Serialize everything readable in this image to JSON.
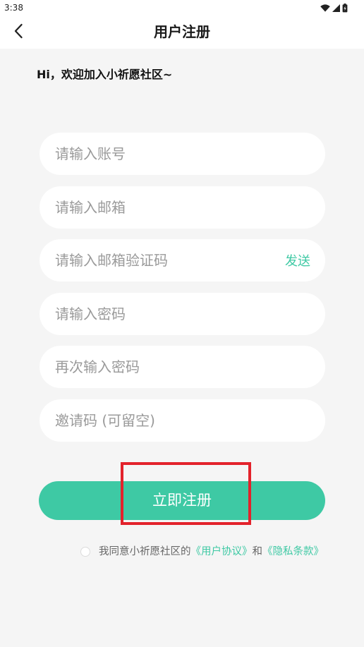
{
  "status_bar": {
    "time": "3:38",
    "icons": [
      "wifi-icon",
      "signal-icon",
      "battery-icon"
    ]
  },
  "header": {
    "title": "用户注册",
    "back_icon": "chevron-left-icon"
  },
  "greeting": "Hi，欢迎加入小祈愿社区~",
  "form": {
    "fields": [
      {
        "placeholder": "请输入账号",
        "value": ""
      },
      {
        "placeholder": "请输入邮箱",
        "value": ""
      },
      {
        "placeholder": "请输入邮箱验证码",
        "value": ""
      },
      {
        "placeholder": "请输入密码",
        "value": ""
      },
      {
        "placeholder": "再次输入密码",
        "value": ""
      },
      {
        "placeholder": "邀请码 (可留空)",
        "value": ""
      }
    ],
    "send_code_label": "发送"
  },
  "submit_label": "立即注册",
  "agreement": {
    "checked": false,
    "prefix": "我同意小祈愿社区的",
    "terms_link": "《用户协议》",
    "conjunction": "和",
    "privacy_link": "《隐私条款》"
  },
  "colors": {
    "accent": "#3ec9a4",
    "background": "#f5f5f5",
    "highlight": "#e3222b",
    "muted": "#9a9a9a"
  }
}
